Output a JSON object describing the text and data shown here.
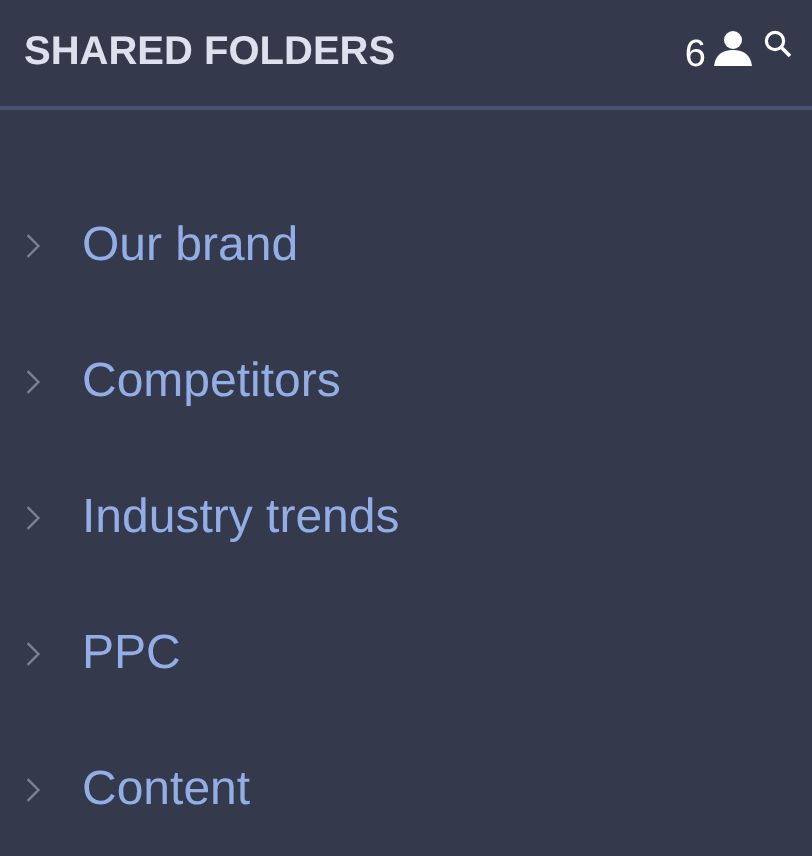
{
  "header": {
    "title": "SHARED FOLDERS",
    "member_count": "6"
  },
  "folders": [
    {
      "label": "Our brand",
      "expanded": false
    },
    {
      "label": "Competitors",
      "expanded": false
    },
    {
      "label": "Industry trends",
      "expanded": false
    },
    {
      "label": "PPC",
      "expanded": false
    },
    {
      "label": "Content",
      "expanded": false
    }
  ]
}
